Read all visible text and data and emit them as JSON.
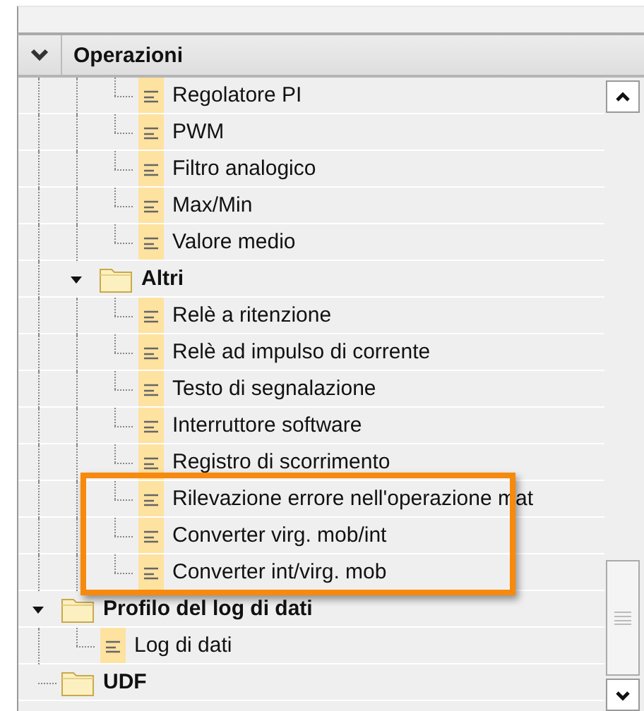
{
  "section": {
    "title": "Operazioni",
    "expanded": true
  },
  "tree": [
    {
      "children": [
        {
          "children": [
            {
              "kind": "leaf",
              "label": "Regolatore PI"
            },
            {
              "kind": "leaf",
              "label": "PWM"
            },
            {
              "kind": "leaf",
              "label": "Filtro analogico"
            },
            {
              "kind": "leaf",
              "label": "Max/Min"
            },
            {
              "kind": "leaf",
              "label": "Valore medio"
            }
          ]
        },
        {
          "kind": "folder",
          "label": "Altri",
          "expanded": true,
          "children": [
            {
              "kind": "leaf",
              "label": "Relè a ritenzione"
            },
            {
              "kind": "leaf",
              "label": "Relè ad impulso di corrente"
            },
            {
              "kind": "leaf",
              "label": "Testo di segnalazione"
            },
            {
              "kind": "leaf",
              "label": "Interruttore software"
            },
            {
              "kind": "leaf",
              "label": "Registro di scorrimento"
            },
            {
              "kind": "leaf",
              "label": "Rilevazione errore nell'operazione mat"
            },
            {
              "kind": "leaf",
              "label": "Converter virg. mob/int"
            },
            {
              "kind": "leaf",
              "label": "Converter int/virg. mob"
            }
          ]
        }
      ]
    },
    {
      "kind": "folder",
      "label": "Profilo del log di dati",
      "expanded": true,
      "children": [
        {
          "kind": "leaf",
          "label": "Log di dati"
        }
      ]
    },
    {
      "kind": "folder",
      "label": "UDF"
    }
  ]
}
